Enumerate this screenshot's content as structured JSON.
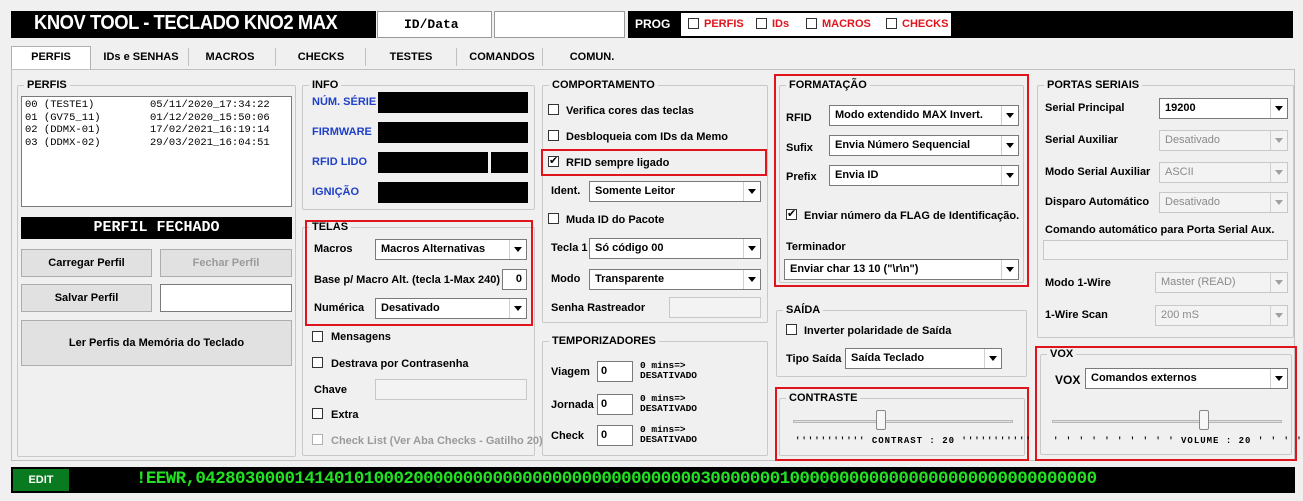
{
  "header": {
    "title": "KNOV TOOL - TECLADO KNO2 MAX",
    "id_data_label": "ID/Data",
    "prog_label": "PROG",
    "checks": [
      {
        "label": "PERFIS",
        "checked": false
      },
      {
        "label": "IDs",
        "checked": false
      },
      {
        "label": "MACROS",
        "checked": false
      },
      {
        "label": "CHECKS",
        "checked": false
      }
    ]
  },
  "tabs": [
    "PERFIS",
    "IDs e SENHAS",
    "MACROS",
    "CHECKS",
    "TESTES",
    "COMANDOS",
    "COMUN."
  ],
  "active_tab": "PERFIS",
  "perfis": {
    "title": "PERFIS",
    "items": [
      {
        "id": "00 (TESTE1)",
        "date": "05/11/2020_17:34:22"
      },
      {
        "id": "01 (GV75_11)",
        "date": "01/12/2020_15:50:06"
      },
      {
        "id": "02 (DDMX-01)",
        "date": "17/02/2021_16:19:14"
      },
      {
        "id": "03 (DDMX-02)",
        "date": "29/03/2021_16:04:51"
      }
    ],
    "status": "PERFIL FECHADO",
    "load_btn": "Carregar Perfil",
    "close_btn": "Fechar Perfil",
    "save_btn": "Salvar Perfil",
    "read_btn": "Ler Perfis da Memória do Teclado"
  },
  "info": {
    "title": "INFO",
    "serial_label": "NÚM. SÉRIE",
    "firmware_label": "FIRMWARE",
    "rfid_label": "RFID LIDO",
    "ignition_label": "IGNIÇÃO"
  },
  "telas": {
    "title": "TELAS",
    "macros_label": "Macros",
    "macros_value": "Macros Alternativas",
    "base_label": "Base p/ Macro Alt. (tecla 1-Max 240)",
    "base_value": "0",
    "numerica_label": "Numérica",
    "numerica_value": "Desativado",
    "mensagens": "Mensagens",
    "destrava": "Destrava por Contrasenha",
    "chave_label": "Chave",
    "extra": "Extra",
    "checklist": "Check List (Ver Aba Checks - Gatilho 20)"
  },
  "comportamento": {
    "title": "COMPORTAMENTO",
    "verifica": "Verifica cores das teclas",
    "desbloqueia": "Desbloqueia com IDs da Memo",
    "rfid_sempre": "RFID sempre ligado",
    "ident_label": "Ident.",
    "ident_value": "Somente Leitor",
    "muda_id": "Muda ID do Pacote",
    "tecla1_label": "Tecla 1",
    "tecla1_value": "Só código 00",
    "modo_label": "Modo",
    "modo_value": "Transparente",
    "senha_label": "Senha Rastreador"
  },
  "temporizadores": {
    "title": "TEMPORIZADORES",
    "rows": [
      {
        "label": "Viagem",
        "value": "0",
        "note1": "0 mins=>",
        "note2": "DESATIVADO"
      },
      {
        "label": "Jornada",
        "value": "0",
        "note1": "0 mins=>",
        "note2": "DESATIVADO"
      },
      {
        "label": "Check",
        "value": "0",
        "note1": "0 mins=>",
        "note2": "DESATIVADO"
      }
    ]
  },
  "formatacao": {
    "title": "FORMATAÇÃO",
    "rfid_label": "RFID",
    "rfid_value": "Modo extendido MAX Invert.",
    "sufix_label": "Sufix",
    "sufix_value": "Envia Número Sequencial",
    "prefix_label": "Prefix",
    "prefix_value": "Envia ID",
    "enviar_flag": "Enviar número da FLAG de Identificação.",
    "terminador_label": "Terminador",
    "terminador_value": "Enviar char 13 10 (\"\\r\\n\")"
  },
  "saida": {
    "title": "SAÍDA",
    "inverter": "Inverter polaridade de Saída",
    "tipo_label": "Tipo Saída",
    "tipo_value": "Saída Teclado"
  },
  "contraste": {
    "title": "CONTRASTE",
    "label": "CONTRAST : 20",
    "value": 20
  },
  "portas": {
    "title": "PORTAS SERIAIS",
    "serial_principal_label": "Serial Principal",
    "serial_principal_value": "19200",
    "serial_aux_label": "Serial Auxiliar",
    "serial_aux_value": "Desativado",
    "modo_serial_aux_label": "Modo Serial Auxiliar",
    "modo_serial_aux_value": "ASCII",
    "disparo_label": "Disparo Automático",
    "disparo_value": "Desativado",
    "comando_label": "Comando automático  para Porta Serial Aux.",
    "modo_1wire_label": "Modo 1-Wire",
    "modo_1wire_value": "Master (READ)",
    "scan_label": "1-Wire Scan",
    "scan_value": "200 mS"
  },
  "vox": {
    "title": "VOX",
    "label": "VOX",
    "value": "Comandos externos",
    "volume_label": "VOLUME : 20",
    "volume": 20
  },
  "footer": {
    "mode": "EDIT",
    "command": "!EEWR,0428030000141401010002000000000000000000000000000003000000010000000000000000000000000000000"
  },
  "colors": {
    "accent_red": "#e0141c",
    "label_blue": "#1f40c8",
    "command_green": "#22e022",
    "edit_green": "#0a7a20"
  }
}
